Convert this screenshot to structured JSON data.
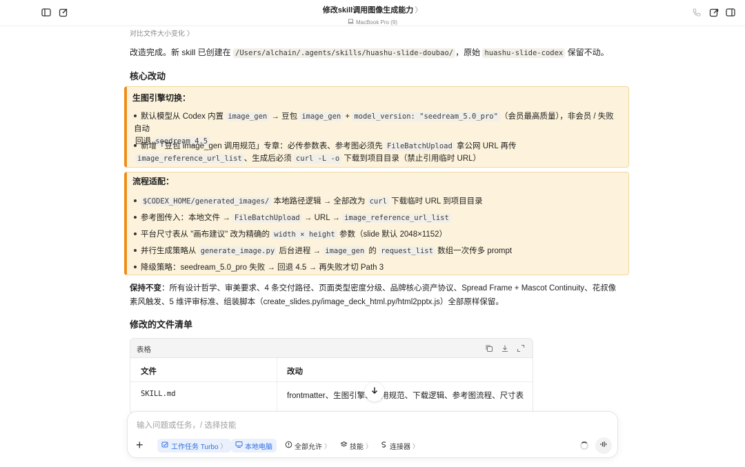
{
  "window": {
    "title": "修改skill调用图像生成能力",
    "title_chevron": "〉",
    "device": "MacBook Pro (9)"
  },
  "chat": {
    "compare_link": "对比文件大小变化 〉",
    "intro": {
      "a": "改造完成。新 skill 已创建在 ",
      "path": "/Users/alchain/.agents/skills/huashu-slide-doubao/",
      "b": "，原始 ",
      "orig": "huashu-slide-codex",
      "c": " 保留不动。"
    },
    "core_heading": "核心改动",
    "engine": {
      "title": "生图引擎切换：",
      "item1": {
        "t1": "默认模型从 Codex 内置 ",
        "c1": "image_gen",
        "t2": " → 豆包 ",
        "c2": "image_gen",
        "t3": " + ",
        "c3": "model_version: \"seedream_5.0_pro\"",
        "t4": "（会员最高质量），非会员 / 失败自动",
        "t5": "回退 ",
        "c4": "seedream_4.5"
      },
      "item2": {
        "t1": "新增「豆包 image_gen 调用规范」专章：必传参数表、参考图必须先 ",
        "c1": "FileBatchUpload",
        "t2": " 拿公网 URL 再传",
        "c2": "image_reference_url_list",
        "t3": "、生成后必须 ",
        "c3": "curl -L -o",
        "t4": " 下载到项目目录（禁止引用临时 URL）"
      }
    },
    "flow": {
      "title": "流程适配：",
      "item1": {
        "c1": "$CODEX_HOME/generated_images/",
        "t1": " 本地路径逻辑 → 全部改为 ",
        "c2": "curl",
        "t2": " 下载临时 URL 到项目目录"
      },
      "item2": {
        "t1": "参考图传入：本地文件 → ",
        "c1": "FileBatchUpload",
        "t2": " → URL → ",
        "c2": "image_reference_url_list"
      },
      "item3": {
        "t1": "平台尺寸表从 \"画布建议\" 改为精确的 ",
        "c1": "width × height",
        "t2": " 参数（slide 默认 2048×1152）"
      },
      "item4": {
        "t1": "并行生成策略从 ",
        "c1": "generate_image.py",
        "t2": " 后台进程 → ",
        "c2": "image_gen",
        "t3": " 的 ",
        "c3": "request_list",
        "t4": " 数组一次传多 prompt"
      },
      "item5": {
        "t1": "降级策略：seedream_5.0_pro 失败 → 回退 4.5 → 再失败才切 Path 3"
      }
    },
    "keep": {
      "bold": "保持不变",
      "text": "：所有设计哲学、审美要求、4 条交付路径、页面类型密度分级、品牌核心资产协议、Spread Frame + Mascot Continuity、花叔像素风触发、5 维评审标准、组装脚本（create_slides.py/image_deck_html.py/html2pptx.js）全部原样保留。"
    },
    "files_heading": "修改的文件清单",
    "table": {
      "label": "表格",
      "headers": [
        "文件",
        "改动"
      ],
      "rows": [
        {
          "file": "SKILL.md",
          "change": "frontmatter、生图引擎、调用规范、下载逻辑、参考图流程、尺寸表"
        }
      ]
    }
  },
  "composer": {
    "placeholder": "输入问题或任务，/ 选择技能",
    "chips": {
      "task": "工作任务 Turbo",
      "local": "本地电脑",
      "allow": "全部允许",
      "skills": "技能",
      "connector": "连接器"
    },
    "chip_arrow": "〉"
  },
  "colors": {
    "accent_orange": "#ef8d1b",
    "callout_bg": "#fdf3dc",
    "chip_blue": "#2d6fe0"
  }
}
